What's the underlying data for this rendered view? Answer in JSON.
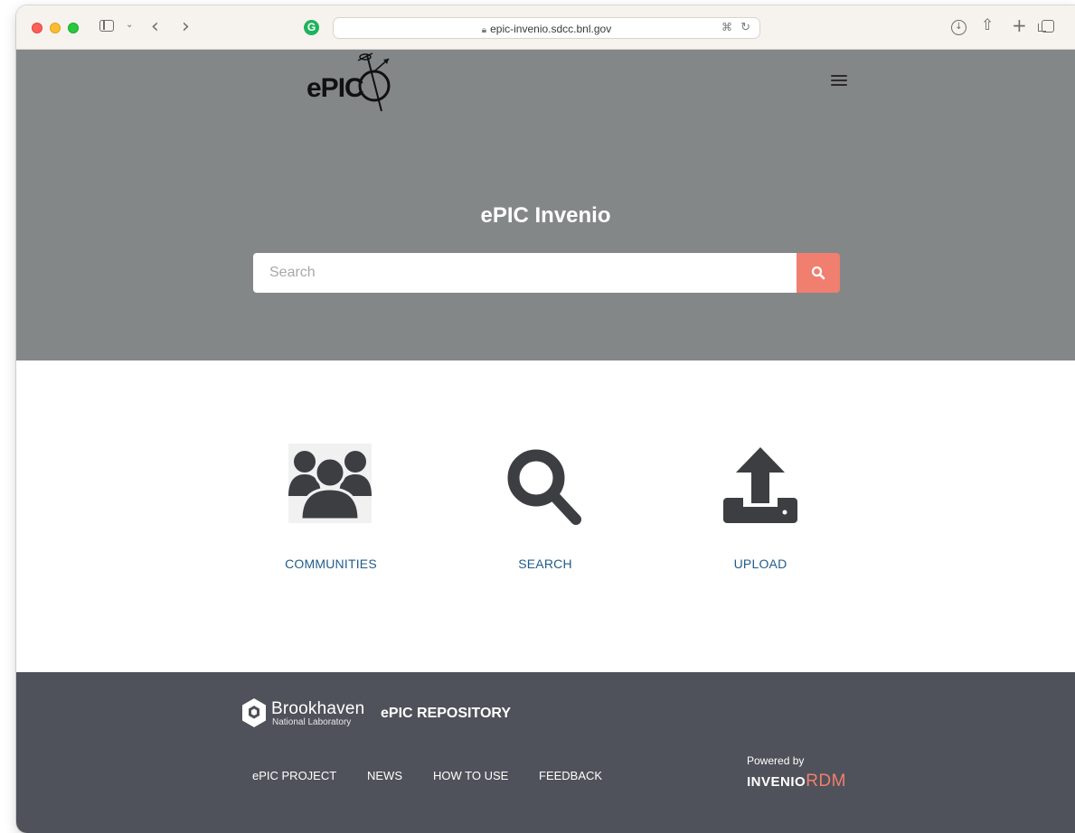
{
  "browser": {
    "url": "epic-invenio.sdcc.bnl.gov"
  },
  "header": {
    "logo_text": "ePIC"
  },
  "hero": {
    "title": "ePIC Invenio",
    "search_placeholder": "Search"
  },
  "features": [
    {
      "label": "COMMUNITIES",
      "icon": "users-icon"
    },
    {
      "label": "SEARCH",
      "icon": "magnifier-icon"
    },
    {
      "label": "UPLOAD",
      "icon": "upload-icon"
    }
  ],
  "footer": {
    "brand_name": "Brookhaven",
    "brand_sub": "National Laboratory",
    "repo_title": "ePIC REPOSITORY",
    "links": [
      "ePIC PROJECT",
      "NEWS",
      "HOW TO USE",
      "FEEDBACK"
    ],
    "powered_by": "Powered by",
    "invenio_a": "INVENIO",
    "invenio_b": "RDM"
  },
  "colors": {
    "hero_bg": "#848788",
    "accent": "#f07f6f",
    "link": "#1f5c8a",
    "footer_bg": "#4f525a",
    "icon": "#3d3e42"
  }
}
